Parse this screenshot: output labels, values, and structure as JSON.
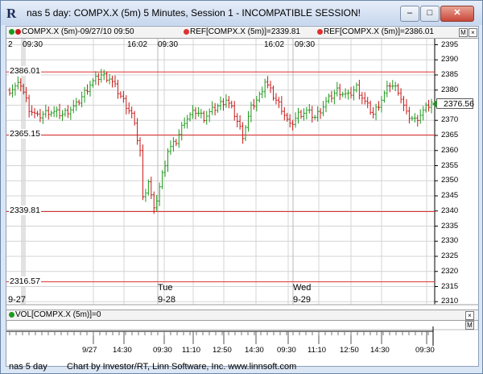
{
  "window": {
    "title": "nas 5 day: COMPX.X (5m) 5 Minutes, Session 1 - INCOMPATIBLE SESSION!",
    "min_label": "–",
    "max_label": "□",
    "close_label": "✕"
  },
  "legend": {
    "series": "COMPX.X (5m)-09/27/10 09:50",
    "ref1": "REF[COMPX.X (5m)]=2339.81",
    "ref2": "REF[COMPX.X (5m)]=2386.01",
    "maximize_label": "M",
    "collapse_label": "×"
  },
  "session_labels": [
    "2",
    "09:30",
    "16:02",
    "09:30",
    "16:02",
    "09:30"
  ],
  "day_labels": [
    "9-27",
    "Tue",
    "9-28",
    "Wed",
    "9-29"
  ],
  "volume": {
    "label": "VOL[COMPX.X (5m)]=0",
    "maximize_label": "M",
    "collapse_label": "×"
  },
  "price_tag": "2376.56",
  "reference_lines": [
    {
      "label": "2386.01",
      "value": 2386.01
    },
    {
      "label": "2365.15",
      "value": 2365.15
    },
    {
      "label": "2339.81",
      "value": 2339.81
    },
    {
      "label": "2316.57",
      "value": 2316.57
    }
  ],
  "chart_data": {
    "type": "line",
    "subtype": "ohlc-bars",
    "symbol": "COMPX.X",
    "interval": "5m",
    "ylim": [
      2309,
      2397
    ],
    "y_ticks": [
      2395,
      2390,
      2385,
      2380,
      2375,
      2370,
      2365,
      2360,
      2355,
      2350,
      2345,
      2340,
      2335,
      2330,
      2325,
      2320,
      2315,
      2310
    ],
    "x_ticks": [
      "9/27",
      "14:30",
      "09:30",
      "11:10",
      "12:50",
      "14:30",
      "09:30",
      "11:10",
      "12:50",
      "14:30",
      "09:30"
    ],
    "close_path": [
      [
        0,
        2380
      ],
      [
        4,
        2382
      ],
      [
        7,
        2374
      ],
      [
        10,
        2371
      ],
      [
        14,
        2373
      ],
      [
        19,
        2372
      ],
      [
        24,
        2375
      ],
      [
        29,
        2382
      ],
      [
        33,
        2385
      ],
      [
        36,
        2384
      ],
      [
        40,
        2378
      ],
      [
        44,
        2372
      ],
      [
        47,
        2360
      ],
      [
        48,
        2344
      ],
      [
        50,
        2350
      ],
      [
        52,
        2340
      ],
      [
        54,
        2348
      ],
      [
        57,
        2360
      ],
      [
        60,
        2363
      ],
      [
        63,
        2370
      ],
      [
        67,
        2373
      ],
      [
        70,
        2371
      ],
      [
        74,
        2374
      ],
      [
        78,
        2377
      ],
      [
        81,
        2372
      ],
      [
        84,
        2365
      ],
      [
        87,
        2374
      ],
      [
        90,
        2378
      ],
      [
        92,
        2383
      ],
      [
        95,
        2378
      ],
      [
        98,
        2374
      ],
      [
        101,
        2368
      ],
      [
        104,
        2372
      ],
      [
        107,
        2373
      ],
      [
        110,
        2371
      ],
      [
        114,
        2376
      ],
      [
        118,
        2380
      ],
      [
        122,
        2378
      ],
      [
        125,
        2381
      ],
      [
        128,
        2376
      ],
      [
        131,
        2372
      ],
      [
        134,
        2377
      ],
      [
        137,
        2382
      ],
      [
        140,
        2380
      ],
      [
        143,
        2372
      ],
      [
        146,
        2370
      ],
      [
        149,
        2373
      ],
      [
        152,
        2376
      ]
    ],
    "last": 2376.56,
    "grid": true,
    "legend_position": "top"
  },
  "status": {
    "left": "nas 5 day",
    "center": "Chart by Investor/RT, Linn Software, Inc. www.linnsoft.com"
  },
  "colors": {
    "up_bar": "#1c9a1c",
    "down_bar": "#c81818",
    "reference_line": "#e03030",
    "grid": "#d4d4d4"
  }
}
